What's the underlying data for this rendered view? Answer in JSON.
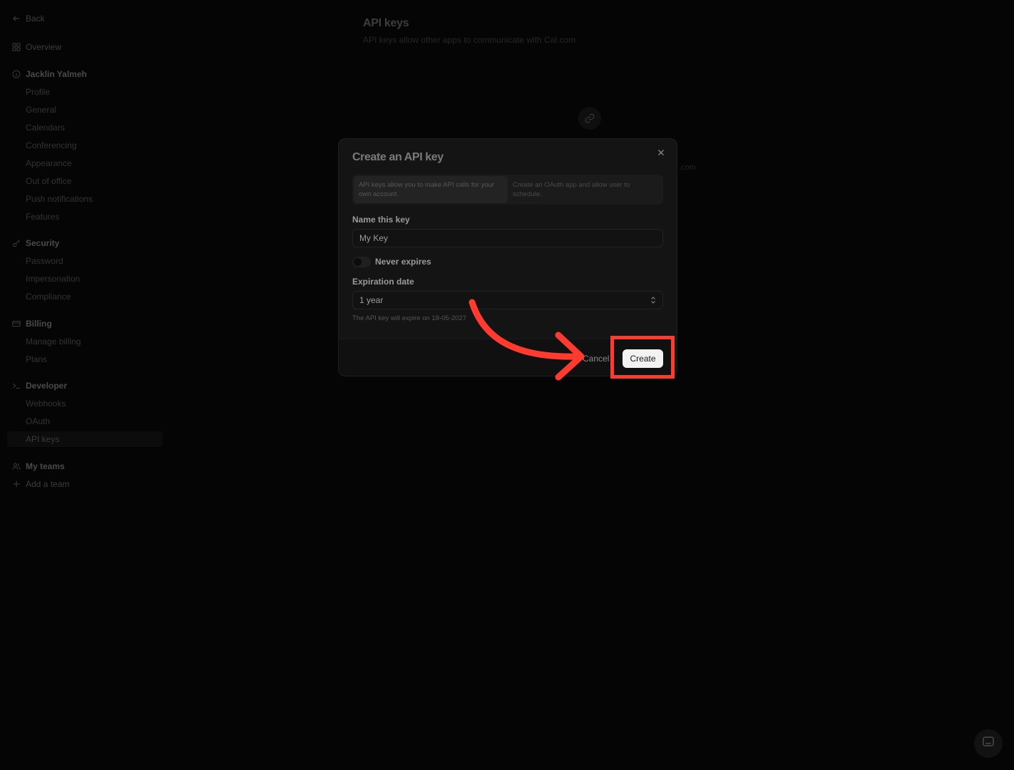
{
  "sidebar": {
    "back": "Back",
    "overview": "Overview",
    "user_section": "Jacklin Yalmeh",
    "user_items": [
      "Profile",
      "General",
      "Calendars",
      "Conferencing",
      "Appearance",
      "Out of office",
      "Push notifications",
      "Features"
    ],
    "security_section": "Security",
    "security_items": [
      "Password",
      "Impersonation",
      "Compliance"
    ],
    "billing_section": "Billing",
    "billing_items": [
      "Manage billing",
      "Plans"
    ],
    "developer_section": "Developer",
    "developer_items": [
      "Webhooks",
      "OAuth",
      "API keys"
    ],
    "teams_section": "My teams",
    "add_team": "Add a team"
  },
  "page": {
    "title": "API keys",
    "subtitle": "API keys allow other apps to communicate with Cal.com",
    "ghost": ".com"
  },
  "modal": {
    "title": "Create an API key",
    "tabs": [
      "API keys allow you to make API calls for your own account.",
      "Create an OAuth app and allow user to schedule."
    ],
    "name_label": "Name this key",
    "name_value": "My Key",
    "never_expires_label": "Never expires",
    "expiration_label": "Expiration date",
    "expiration_value": "1 year",
    "hint": "The API key will expire on 18-05-2027",
    "cancel": "Cancel",
    "create": "Create"
  },
  "colors": {
    "annotation": "#ff3b30",
    "background": "#050505"
  }
}
